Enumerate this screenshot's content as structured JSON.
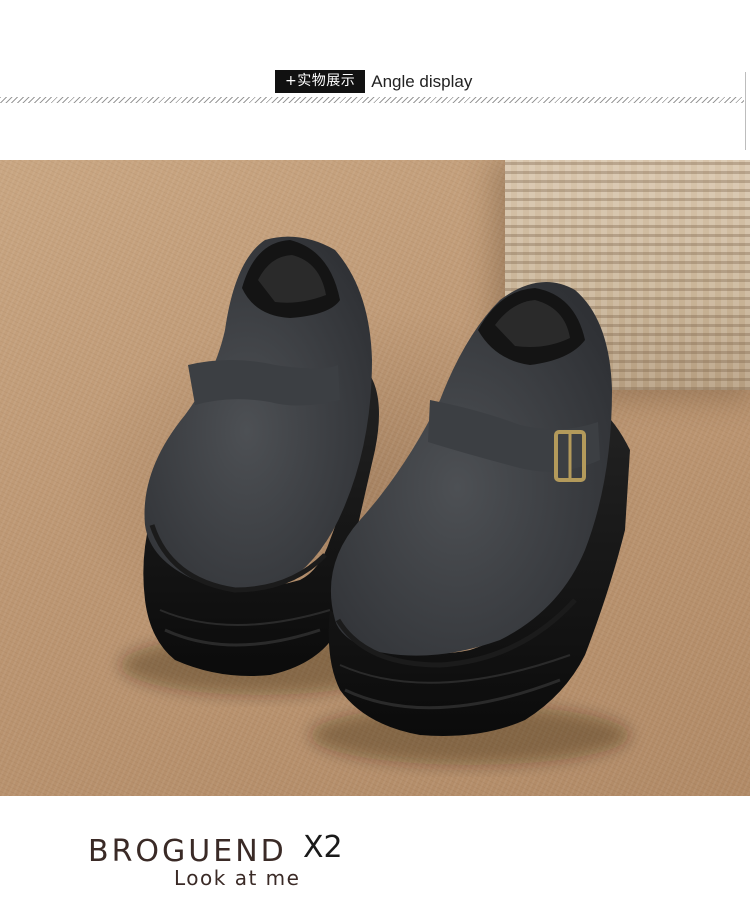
{
  "header": {
    "label_cn": "+实物展示",
    "label_en": "Angle display"
  },
  "photo": {
    "subject": "two dark grey felt platform loafers with buckle strap on carpet"
  },
  "footer": {
    "brand": "BROGUEND",
    "quantity": "X2",
    "tagline": "Look at me"
  },
  "colors": {
    "label_bg": "#111111",
    "brand_text": "#3a2a26",
    "shoe_felt": "#3e4044",
    "sole": "#151515",
    "buckle": "#b39a5b"
  }
}
